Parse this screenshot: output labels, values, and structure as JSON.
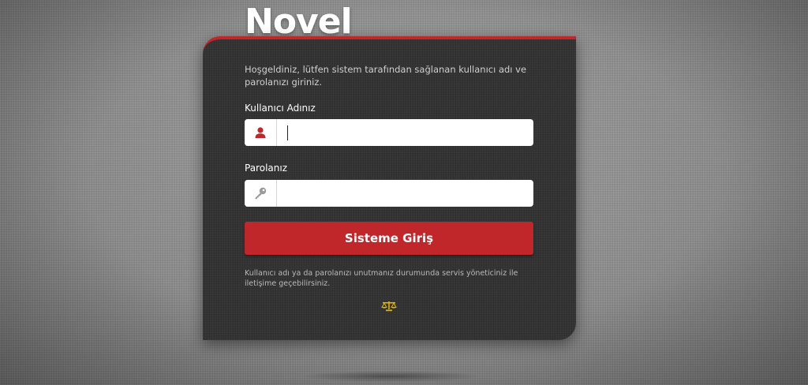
{
  "brand": {
    "name": "Novel"
  },
  "login": {
    "intro": "Hoşgeldiniz, lütfen sistem tarafından sağlanan kullanıcı adı ve parolanızı giriniz.",
    "username_label": "Kullanıcı Adınız",
    "username_value": "",
    "username_icon": "user-icon",
    "password_label": "Parolanız",
    "password_value": "",
    "password_icon": "key-icon",
    "submit_label": "Sisteme Giriş",
    "help_note": "Kullanıcı adı ya da parolanızı unutmanız durumunda servis yöneticiniz ile iletişime geçebilirsiniz.",
    "footer_icon": "balance-scale-icon"
  },
  "colors": {
    "accent": "#c0272a",
    "card": "#2e2e2e",
    "footer_icon": "#e2b400"
  }
}
